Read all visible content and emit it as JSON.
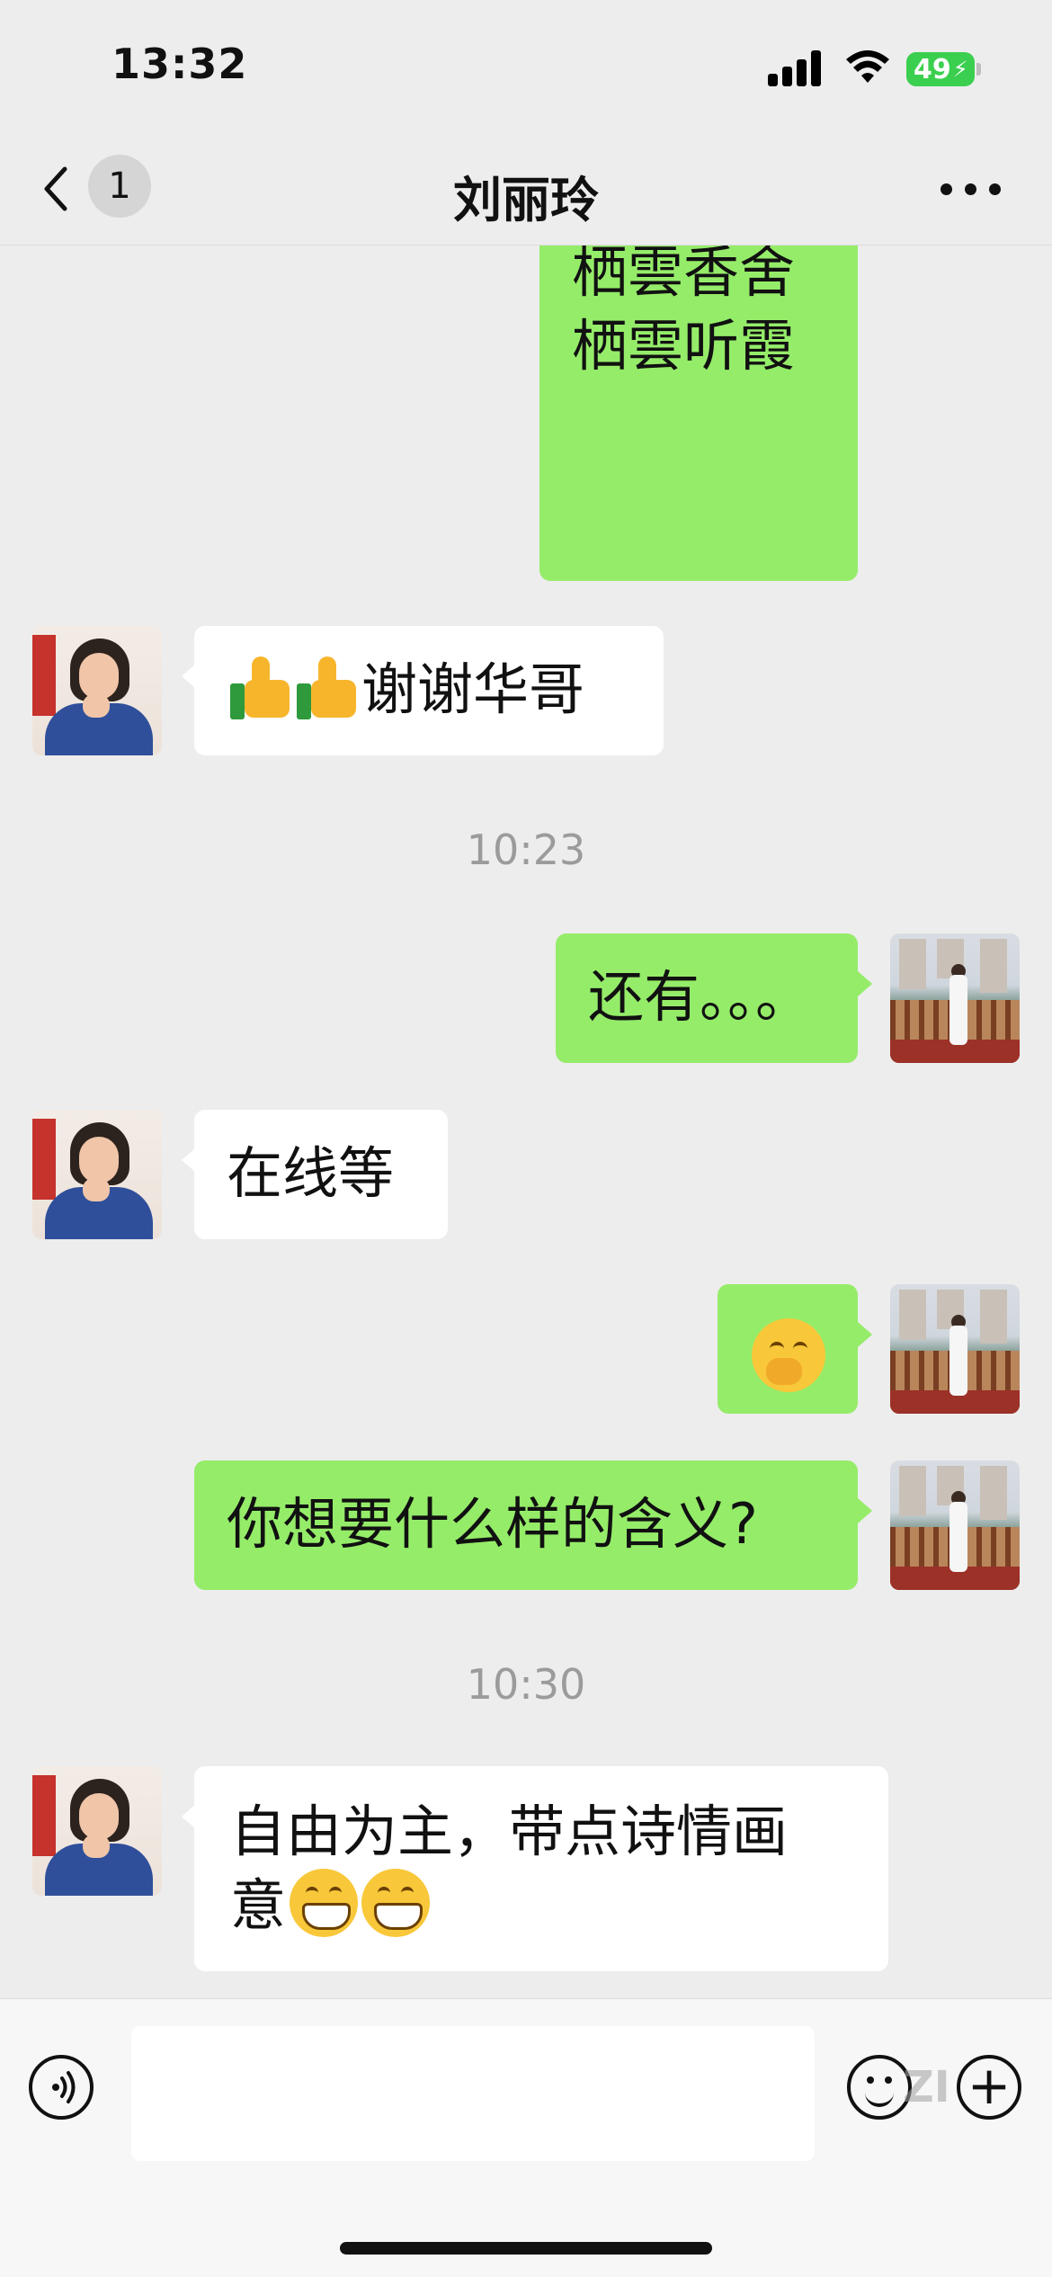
{
  "status_bar": {
    "time": "13:32",
    "battery": "49"
  },
  "header": {
    "unread_count": "1",
    "title": "刘丽玲"
  },
  "messages": {
    "m1": {
      "line1": "栖雲香舍",
      "line2": "栖雲听霞"
    },
    "m2": {
      "text": "谢谢华哥"
    },
    "ts1": "10:23",
    "m3": {
      "text": "还有。。。"
    },
    "m4": {
      "text": "在线等"
    },
    "m6": {
      "text": "你想要什么样的含义?"
    },
    "ts2": "10:30",
    "m7": {
      "line1": "自由为主，带点诗情画",
      "line2": "意"
    }
  },
  "input_bar": {
    "placeholder": "",
    "watermark": "ZI"
  },
  "icons": {
    "back": "chevron-left-icon",
    "more": "more-dots-icon",
    "voice": "voice-icon",
    "emoji": "emoji-icon",
    "plus": "plus-icon",
    "thumbs_up": "thumbs-up-emoji",
    "grin": "grinning-emoji",
    "thinking": "thinking-emoji"
  },
  "colors": {
    "outgoing_bubble": "#95ec69",
    "incoming_bubble": "#ffffff",
    "background": "#ededed"
  }
}
